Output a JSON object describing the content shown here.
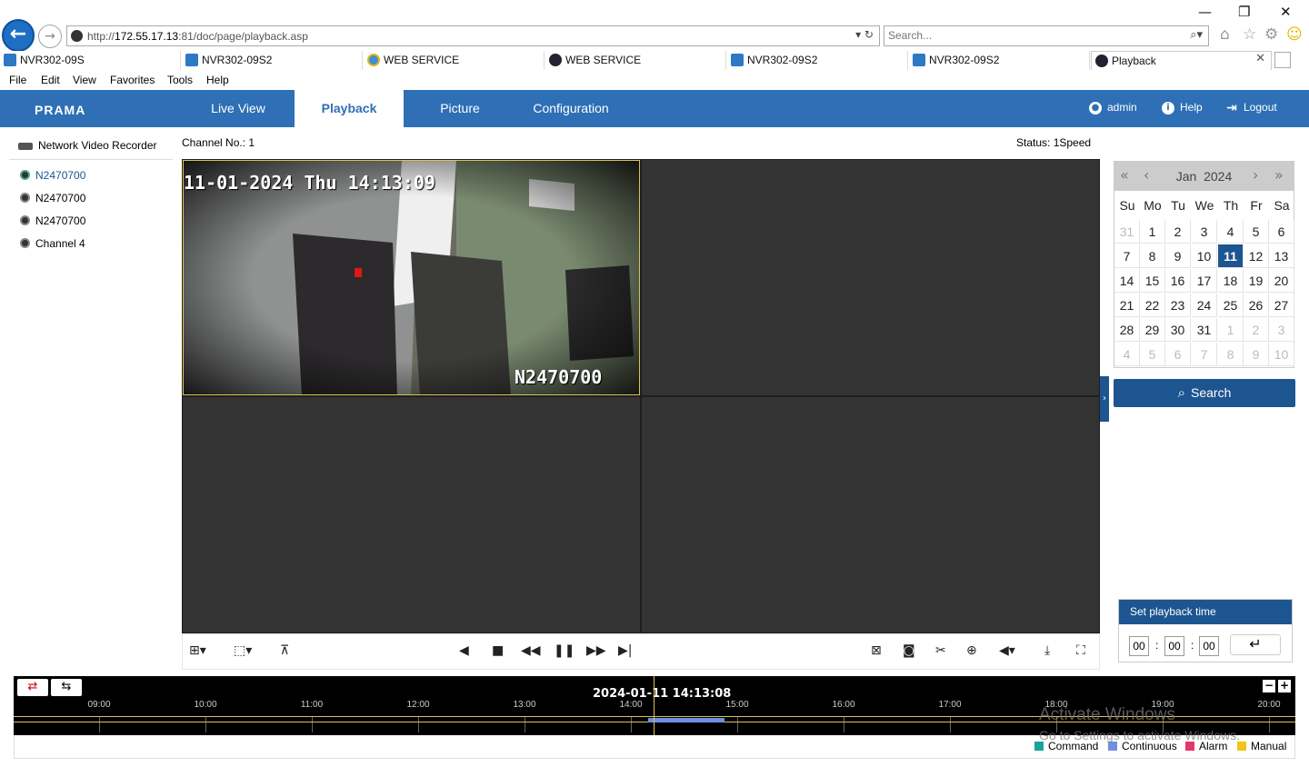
{
  "browser": {
    "url_prefix": "http://",
    "url_host": "172.55.17.13",
    "url_rest": ":81/doc/page/playback.asp",
    "search_placeholder": "Search...",
    "menu": [
      "File",
      "Edit",
      "View",
      "Favorites",
      "Tools",
      "Help"
    ],
    "tabs": [
      {
        "label": "NVR302-09S",
        "icon": "nvr-icon"
      },
      {
        "label": "NVR302-09S2",
        "icon": "nvr-icon"
      },
      {
        "label": "WEB SERVICE",
        "icon": "ie-icon"
      },
      {
        "label": "WEB SERVICE",
        "icon": "webservice-icon"
      },
      {
        "label": "NVR302-09S2",
        "icon": "nvr-icon"
      },
      {
        "label": "NVR302-09S2",
        "icon": "nvr-icon"
      },
      {
        "label": "Playback",
        "icon": "webservice-icon"
      }
    ]
  },
  "app": {
    "logo": "PRAMA",
    "nav": [
      "Live View",
      "Playback",
      "Picture",
      "Configuration"
    ],
    "active_nav": "Playback",
    "user": "admin",
    "help": "Help",
    "logout": "Logout",
    "accent": "#2e6fb5"
  },
  "tree": {
    "root": "Network Video Recorder",
    "items": [
      "N2470700",
      "N2470700",
      "N2470700",
      "Channel 4"
    ]
  },
  "player": {
    "channel_label": "Channel No.: 1",
    "status_label": "Status: 1Speed",
    "osd_datetime": "11-01-2024 Thu 14:13:09",
    "osd_name": "N2470700"
  },
  "calendar": {
    "month": "Jan",
    "year": "2024",
    "dow": [
      "Su",
      "Mo",
      "Tu",
      "We",
      "Th",
      "Fr",
      "Sa"
    ],
    "days": [
      [
        "31",
        "1",
        "2",
        "3",
        "4",
        "5",
        "6"
      ],
      [
        "7",
        "8",
        "9",
        "10",
        "11",
        "12",
        "13"
      ],
      [
        "14",
        "15",
        "16",
        "17",
        "18",
        "19",
        "20"
      ],
      [
        "21",
        "22",
        "23",
        "24",
        "25",
        "26",
        "27"
      ],
      [
        "28",
        "29",
        "30",
        "31",
        "1",
        "2",
        "3"
      ],
      [
        "4",
        "5",
        "6",
        "7",
        "8",
        "9",
        "10"
      ]
    ],
    "selected": "11",
    "search_label": "Search"
  },
  "playback_time": {
    "title": "Set playback time",
    "hh": "00",
    "mm": "00",
    "ss": "00"
  },
  "timeline": {
    "current": "2024-01-11 14:13:08",
    "hours": [
      "09:00",
      "10:00",
      "11:00",
      "12:00",
      "13:00",
      "14:00",
      "15:00",
      "16:00",
      "17:00",
      "18:00",
      "19:00",
      "20:00"
    ],
    "legend": [
      {
        "label": "Command",
        "color": "#1aa39a"
      },
      {
        "label": "Continuous",
        "color": "#6f8fe0"
      },
      {
        "label": "Alarm",
        "color": "#e8356a"
      },
      {
        "label": "Manual",
        "color": "#f0c419"
      }
    ]
  },
  "watermark": {
    "line1": "Activate Windows",
    "line2": "Go to Settings to activate Windows."
  }
}
